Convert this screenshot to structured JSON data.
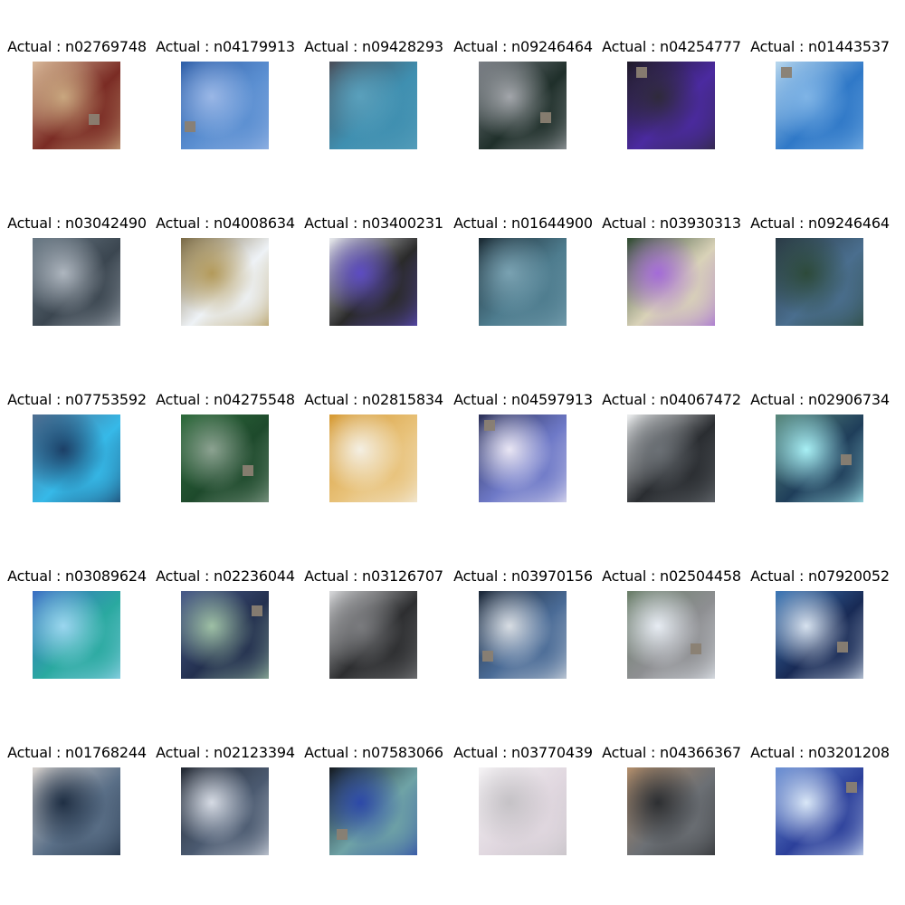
{
  "figure": {
    "label_prefix": "Actual : ",
    "rows": [
      [
        {
          "label": "n02769748",
          "colors": [
            "#d9b99a",
            "#7a2b24",
            "#c9a77f"
          ],
          "patch": "#8a7f72"
        },
        {
          "label": "n04179913",
          "colors": [
            "#2f5fa8",
            "#5b8fd1",
            "#9ab7e6"
          ],
          "patch": "#8a7f72"
        },
        {
          "label": "n09428293",
          "colors": [
            "#4a4e59",
            "#3f8fb0",
            "#5aa0bc"
          ],
          "patch": ""
        },
        {
          "label": "n09246464",
          "colors": [
            "#7b7f86",
            "#1f2f2a",
            "#a3a6ab"
          ],
          "patch": "#8a7f72"
        },
        {
          "label": "n04254777",
          "colors": [
            "#1e1a26",
            "#4b2aa0",
            "#2f2a3b"
          ],
          "patch": "#8a7f72"
        },
        {
          "label": "n01443537",
          "colors": [
            "#b9d8ee",
            "#2f78c7",
            "#7fb4e6"
          ],
          "patch": "#8a7f72"
        }
      ],
      [
        {
          "label": "n03042490",
          "colors": [
            "#6b7a86",
            "#3b4650",
            "#aeb6bf"
          ],
          "patch": ""
        },
        {
          "label": "n04008634",
          "colors": [
            "#7a6a45",
            "#eef2f6",
            "#b39a5a"
          ],
          "patch": ""
        },
        {
          "label": "n03400231",
          "colors": [
            "#e7e9ee",
            "#2a2a2a",
            "#5d4cc2"
          ],
          "patch": ""
        },
        {
          "label": "n01644900",
          "colors": [
            "#1b2a33",
            "#4e7c8e",
            "#7aa2b2"
          ],
          "patch": ""
        },
        {
          "label": "n03930313",
          "colors": [
            "#2f4a32",
            "#d9d2b8",
            "#a46bd8"
          ],
          "patch": ""
        },
        {
          "label": "n09246464",
          "colors": [
            "#2a3a45",
            "#4a6e8e",
            "#2d4a3a"
          ],
          "patch": ""
        }
      ],
      [
        {
          "label": "n07753592",
          "colors": [
            "#4d6b8e",
            "#36b9e8",
            "#1c3f66"
          ],
          "patch": ""
        },
        {
          "label": "n04275548",
          "colors": [
            "#2e6b3c",
            "#1e4a2c",
            "#8ca291"
          ],
          "patch": "#8a7f72"
        },
        {
          "label": "n02815834",
          "colors": [
            "#d69a33",
            "#e8c27a",
            "#f4efe3"
          ],
          "patch": ""
        },
        {
          "label": "n04597913",
          "colors": [
            "#2a2f57",
            "#6e79c7",
            "#e9e6f4"
          ],
          "patch": "#8a7f72"
        },
        {
          "label": "n04067472",
          "colors": [
            "#eceeef",
            "#2a2d31",
            "#6b7075"
          ],
          "patch": ""
        },
        {
          "label": "n02906734",
          "colors": [
            "#5a8a7e",
            "#1f3e5a",
            "#a8f0f5"
          ],
          "patch": "#8a7f72"
        }
      ],
      [
        {
          "label": "n03089624",
          "colors": [
            "#3c6fc4",
            "#2aa9a0",
            "#9bd6ef"
          ],
          "patch": ""
        },
        {
          "label": "n02236044",
          "colors": [
            "#4a5c8a",
            "#23304f",
            "#9ec0a5"
          ],
          "patch": "#8a7f72"
        },
        {
          "label": "n03126707",
          "colors": [
            "#d7d8da",
            "#2d2e30",
            "#7a7b7e"
          ],
          "patch": ""
        },
        {
          "label": "n03970156",
          "colors": [
            "#1c2838",
            "#4a6b96",
            "#d8dde3"
          ],
          "patch": "#8a7f72"
        },
        {
          "label": "n02504458",
          "colors": [
            "#6b7f6a",
            "#8e8f92",
            "#e7ecf3"
          ],
          "patch": "#8a7f72"
        },
        {
          "label": "n07920052",
          "colors": [
            "#3f79b8",
            "#182a55",
            "#d7e2ef"
          ],
          "patch": "#8a7f72"
        }
      ],
      [
        {
          "label": "n01768244",
          "colors": [
            "#d8d3cf",
            "#5a6f87",
            "#1f2f44"
          ],
          "patch": ""
        },
        {
          "label": "n02123394",
          "colors": [
            "#232933",
            "#4b5a70",
            "#d6dbe4"
          ],
          "patch": ""
        },
        {
          "label": "n07583066",
          "colors": [
            "#141a22",
            "#6fa3a6",
            "#2d49a8"
          ],
          "patch": "#8a7f72"
        },
        {
          "label": "n03770439",
          "colors": [
            "#f4f2f4",
            "#e0d7df",
            "#c5c2c6"
          ],
          "patch": ""
        },
        {
          "label": "n04366367",
          "colors": [
            "#b08c6a",
            "#6b6f74",
            "#2d2f32"
          ],
          "patch": ""
        },
        {
          "label": "n03201208",
          "colors": [
            "#6f93d5",
            "#2b3f9a",
            "#d9e7f7"
          ],
          "patch": "#8a7f72"
        }
      ]
    ]
  }
}
